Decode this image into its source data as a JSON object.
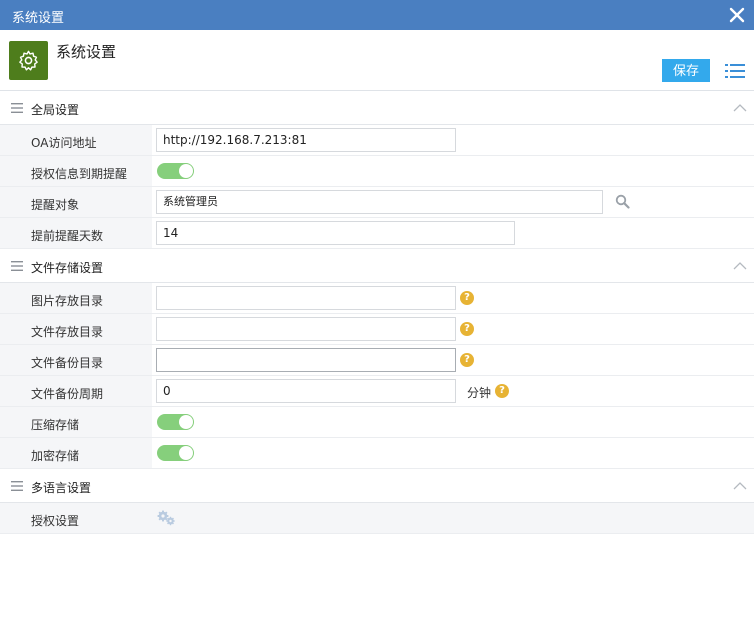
{
  "window": {
    "title": "系统设置"
  },
  "header": {
    "title": "系统设置",
    "save_label": "保存"
  },
  "sections": [
    {
      "title": "全局设置",
      "rows": [
        {
          "label": "OA访问地址",
          "value": "http://192.168.7.213:81"
        },
        {
          "label": "授权信息到期提醒",
          "toggle_on": true
        },
        {
          "label": "提醒对象",
          "value": "系统管理员"
        },
        {
          "label": "提前提醒天数",
          "value": "14"
        }
      ]
    },
    {
      "title": "文件存储设置",
      "rows": [
        {
          "label": "图片存放目录",
          "value": ""
        },
        {
          "label": "文件存放目录",
          "value": ""
        },
        {
          "label": "文件备份目录",
          "value": ""
        },
        {
          "label": "文件备份周期",
          "value": "0",
          "unit": "分钟"
        },
        {
          "label": "压缩存储",
          "toggle_on": true
        },
        {
          "label": "加密存储",
          "toggle_on": true
        }
      ]
    },
    {
      "title": "多语言设置",
      "rows": [
        {
          "label": "授权设置"
        }
      ]
    }
  ],
  "help_glyph": "?",
  "icons": {
    "close": "close-icon",
    "app": "gear-icon",
    "list": "list-icon",
    "section_menu": "menu-icon",
    "collapse": "chevron-up-icon",
    "search": "search-icon",
    "help": "help-icon",
    "settings": "gears-icon"
  },
  "colors": {
    "titlebar": "#4a7fc1",
    "app_icon": "#4e7d1c",
    "save_button": "#33a9ec",
    "toggle_on": "#86cf7c",
    "help": "#e7b334"
  }
}
